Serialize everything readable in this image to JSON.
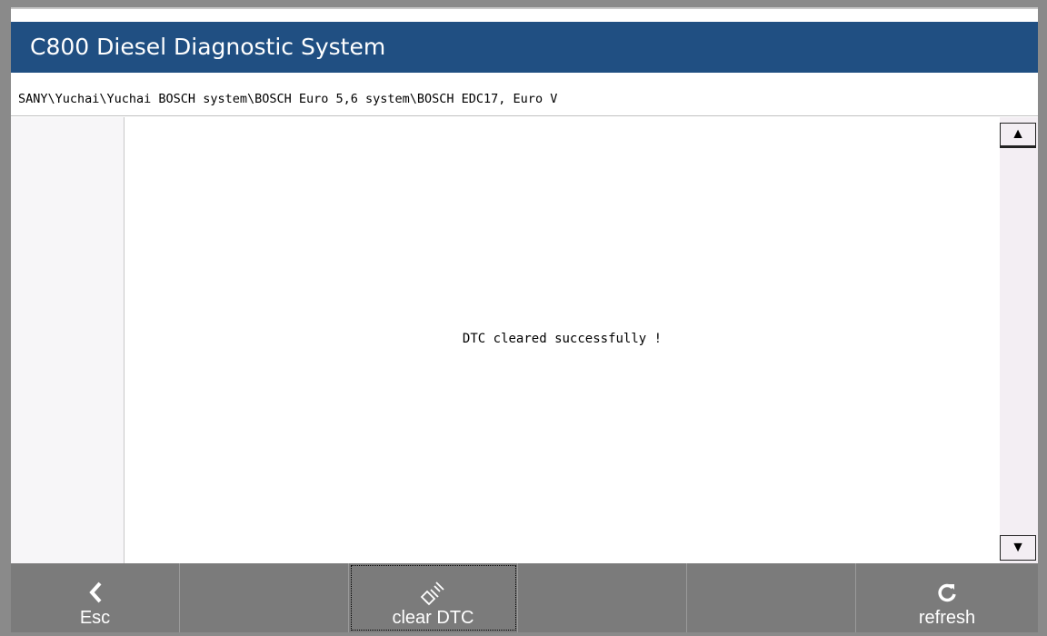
{
  "app": {
    "title": "C800 Diesel Diagnostic System"
  },
  "breadcrumb": {
    "path": "SANY\\Yuchai\\Yuchai BOSCH system\\BOSCH Euro 5,6 system\\BOSCH EDC17, Euro V"
  },
  "content": {
    "message": "DTC cleared successfully !"
  },
  "scrollbar": {
    "up_icon": "triangle-up-icon",
    "down_icon": "triangle-down-icon"
  },
  "toolbar": {
    "buttons": [
      {
        "label": "Esc",
        "icon": "chevron-left-icon"
      },
      {
        "label": "",
        "icon": ""
      },
      {
        "label": "clear DTC",
        "icon": "broom-icon"
      },
      {
        "label": "",
        "icon": ""
      },
      {
        "label": "",
        "icon": ""
      },
      {
        "label": "refresh",
        "icon": "refresh-icon"
      }
    ]
  },
  "colors": {
    "title_bar": "#204f82",
    "toolbar": "#7b7b7b",
    "frame": "#8a8a8a"
  }
}
